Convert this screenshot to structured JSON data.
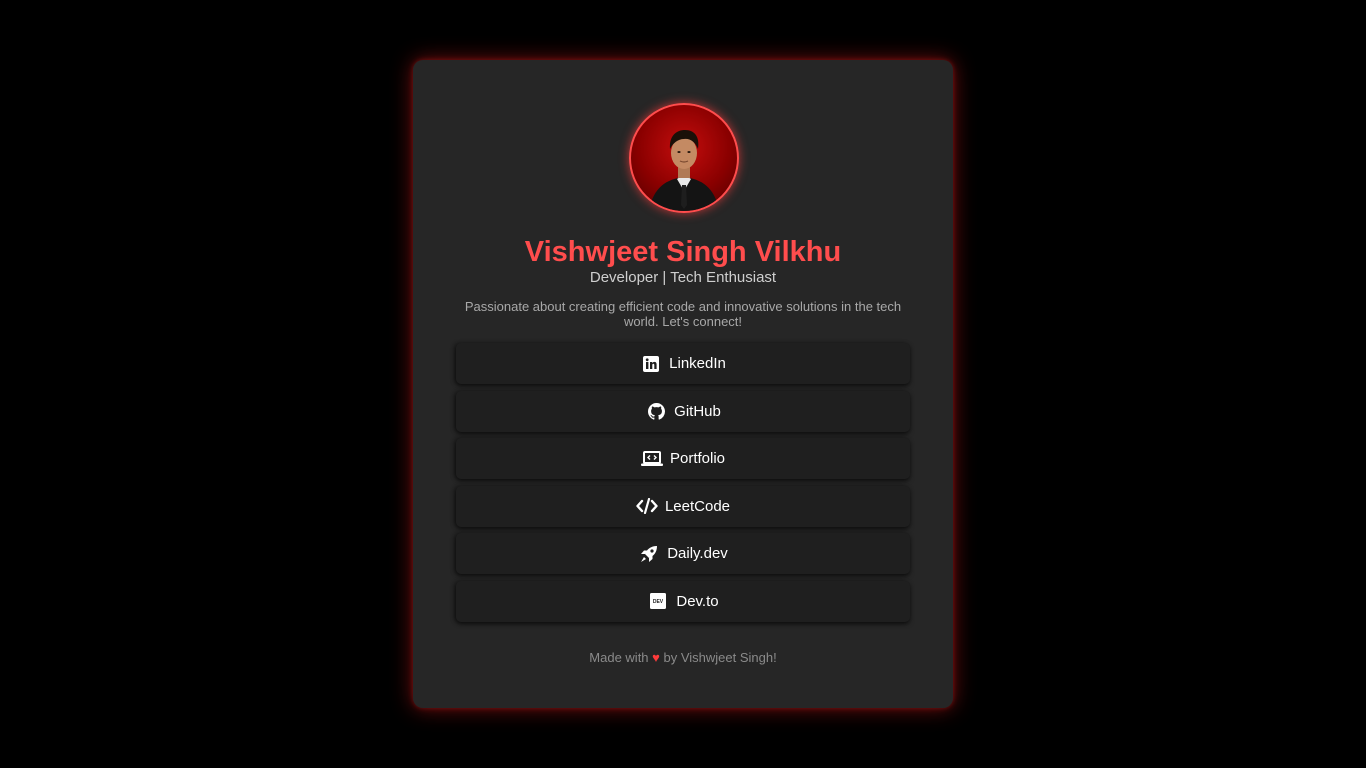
{
  "profile": {
    "name": "Vishwjeet Singh Vilkhu",
    "tagline": "Developer | Tech Enthusiast",
    "bio": "Passionate about creating efficient code and innovative solutions in the tech world. Let's connect!"
  },
  "links": [
    {
      "label": "LinkedIn",
      "icon": "linkedin-icon"
    },
    {
      "label": "GitHub",
      "icon": "github-icon"
    },
    {
      "label": "Portfolio",
      "icon": "laptop-code-icon"
    },
    {
      "label": "LeetCode",
      "icon": "code-icon"
    },
    {
      "label": "Daily.dev",
      "icon": "rocket-icon"
    },
    {
      "label": "Dev.to",
      "icon": "dev-icon"
    }
  ],
  "footer": {
    "prefix": "Made with",
    "heart": "♥",
    "suffix": "by Vishwjeet Singh!"
  },
  "colors": {
    "background": "#000000",
    "card": "#262626",
    "accent": "#ff4d4d",
    "button": "#1f1f1f"
  }
}
